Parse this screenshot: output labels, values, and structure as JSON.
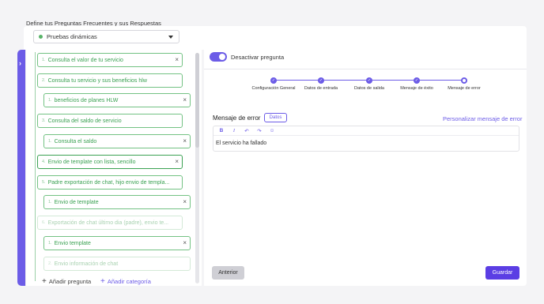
{
  "heading": "Define tus Preguntas Frecuentes y sus Respuestas",
  "flow_select": {
    "value": "Pruebas dinámicas",
    "status_color": "#58b368"
  },
  "questions": [
    {
      "num": "1.",
      "label": "Consulta el valor de tu servicio",
      "closable": true,
      "state": "normal"
    },
    {
      "num": "2.",
      "label": "Consulta tu servicio y sus beneficios hlw",
      "closable": false,
      "state": "normal"
    },
    {
      "num": "1.",
      "label": "beneficios de planes HLW",
      "closable": true,
      "state": "normal"
    },
    {
      "num": "3.",
      "label": "Consulta del saldo de servicio",
      "closable": false,
      "state": "normal"
    },
    {
      "num": "1.",
      "label": "Consulta el saldo",
      "closable": true,
      "state": "normal"
    },
    {
      "num": "4.",
      "label": "Envio de template con lista, sencillo",
      "closable": true,
      "state": "selected"
    },
    {
      "num": "5.",
      "label": "Padre exportación de chat, hijo envio de templa...",
      "closable": false,
      "state": "normal"
    },
    {
      "num": "1.",
      "label": "Envio de template",
      "closable": true,
      "state": "normal"
    },
    {
      "num": "6.",
      "label": "Exportación de chat último dia (padre), envio te...",
      "closable": false,
      "state": "dim"
    },
    {
      "num": "1.",
      "label": "Envio template",
      "closable": true,
      "state": "normal"
    },
    {
      "num": "2.",
      "label": "Envio información de chat",
      "closable": false,
      "state": "dim"
    }
  ],
  "add_question": "Añadir pregunta",
  "add_category": "Añadir categoría",
  "toggle": {
    "label": "Desactivar pregunta",
    "on": true
  },
  "steps": [
    {
      "label": "Configuración General",
      "done": true
    },
    {
      "label": "Datos de entrada",
      "done": true
    },
    {
      "label": "Datos de salida",
      "done": true
    },
    {
      "label": "Mensaje de éxito",
      "done": true
    },
    {
      "label": "Mensaje de error",
      "done": false
    }
  ],
  "error_section": {
    "title": "Mensaje de error",
    "datos_button": "Datos",
    "customize_link": "Personalizar mensaje de error",
    "toolbar": [
      "B",
      "I",
      "↶",
      "↷",
      "☺"
    ],
    "text": "El servicio ha fallado"
  },
  "buttons": {
    "previous": "Anterior",
    "save": "Guardar"
  },
  "colors": {
    "accent": "#6c5ce7",
    "question_green": "#3aa152",
    "save_bg": "#5b3ee4"
  }
}
